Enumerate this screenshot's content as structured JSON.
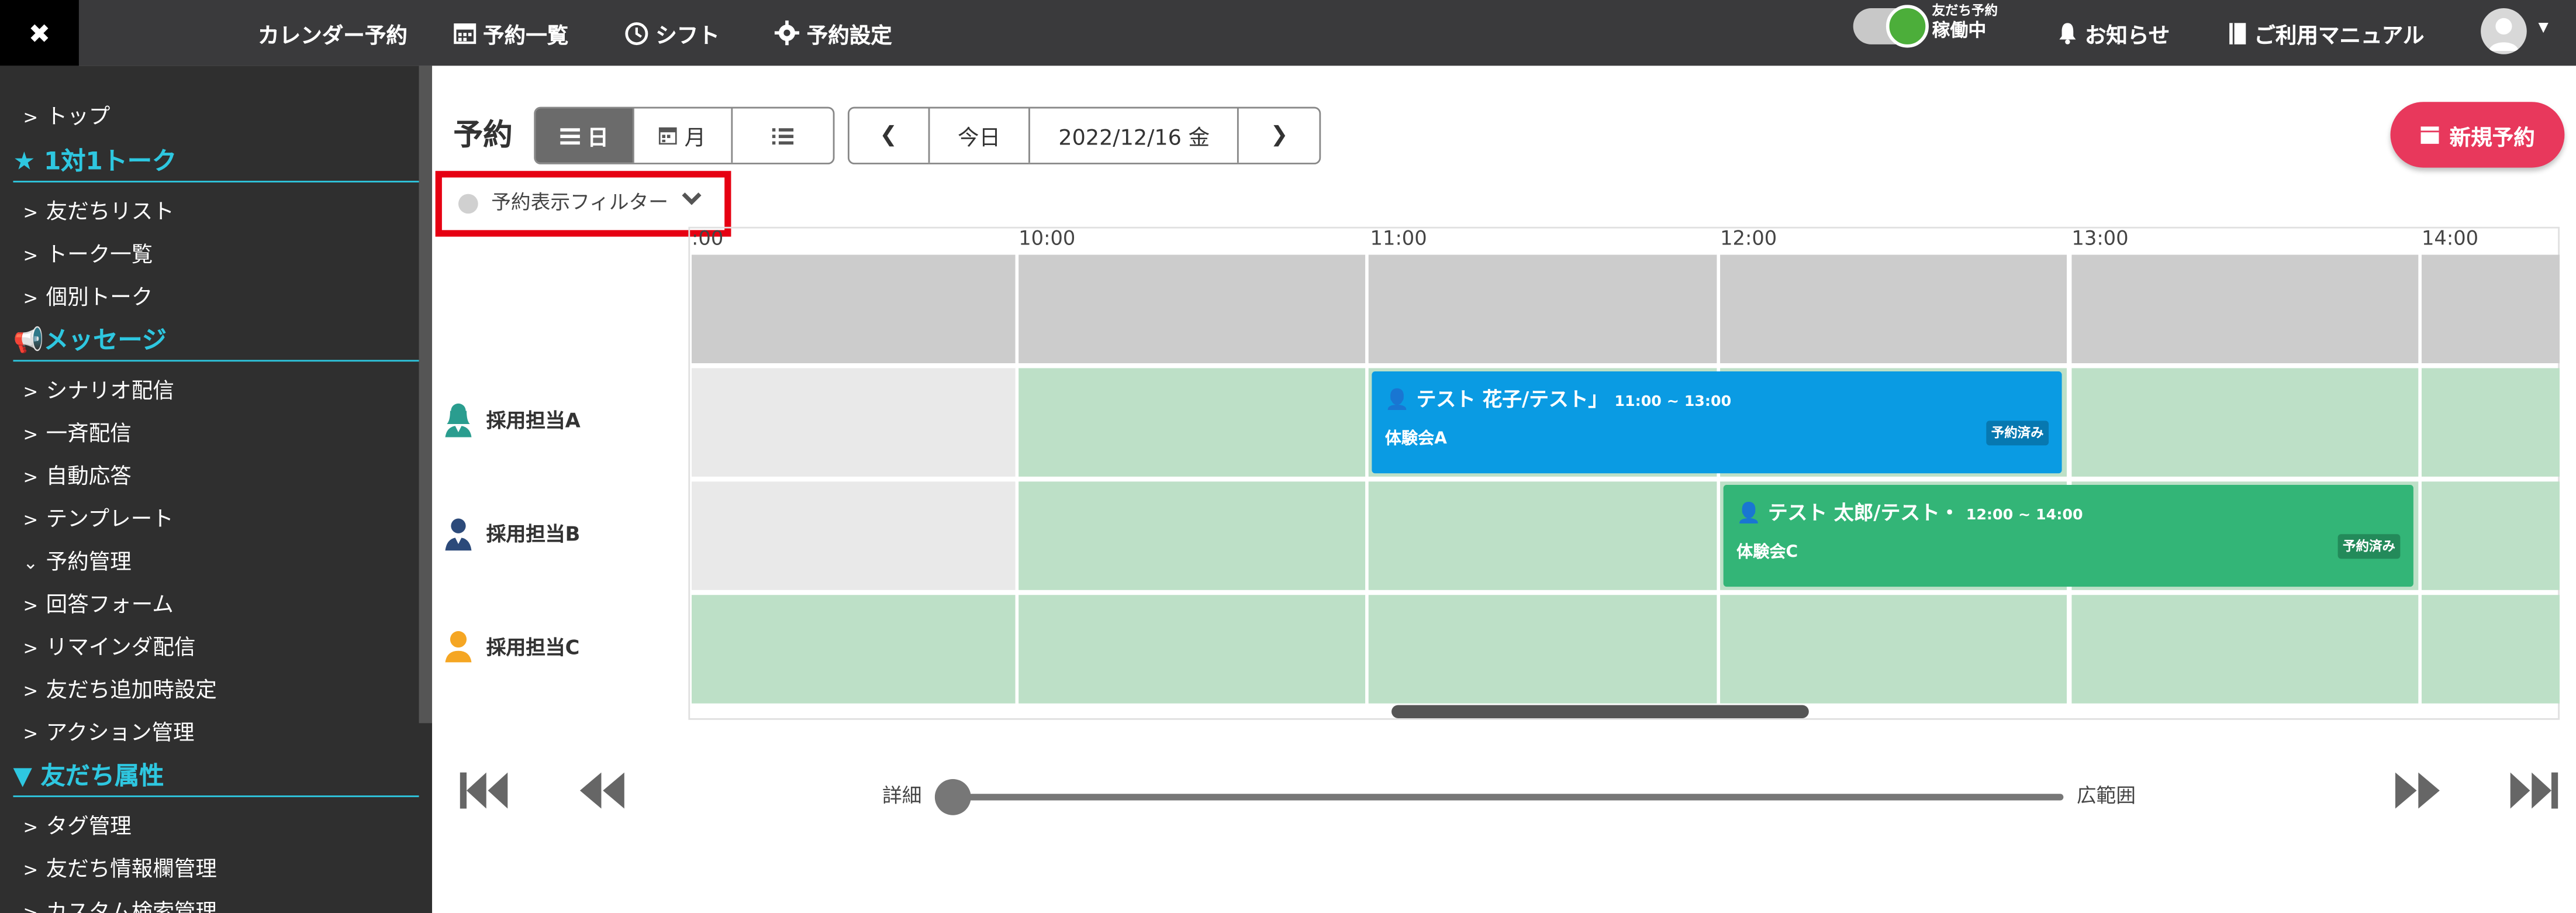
{
  "topbar": {
    "close": "✖",
    "nav": [
      "カレンダー予約",
      "予約一覧",
      "シフト",
      "予約設定"
    ],
    "status_small": "友だち予約",
    "status_main": "稼働中",
    "notice": "お知らせ",
    "manual": "ご利用マニュアル"
  },
  "sidebar": {
    "top": "トップ",
    "section1": "1対1トーク",
    "s1_items": [
      "友だちリスト",
      "トーク一覧",
      "個別トーク"
    ],
    "section2": "メッセージ",
    "s2_items": [
      "シナリオ配信",
      "一斉配信",
      "自動応答",
      "テンプレート",
      "予約管理",
      "回答フォーム",
      "リマインダ配信",
      "友だち追加時設定",
      "アクション管理"
    ],
    "section3": "友だち属性",
    "s3_items": [
      "タグ管理",
      "友だち情報欄管理",
      "カスタム検索管理"
    ]
  },
  "header": {
    "title": "予約",
    "view_day": "日",
    "view_month": "月",
    "today": "今日",
    "date": "2022/12/16 金",
    "new_button": "新規予約",
    "filter": "予約表示フィルター"
  },
  "timeline": {
    "hours": [
      ":00",
      "10:00",
      "11:00",
      "12:00",
      "13:00",
      "14:00"
    ],
    "staff": [
      "採用担当A",
      "採用担当B",
      "採用担当C"
    ],
    "events": [
      {
        "name": "テスト 花子/テスト」",
        "time": "11:00 ~ 13:00",
        "event": "体験会A",
        "status": "予約済み",
        "color": "#0a9be3"
      },
      {
        "name": "テスト 太郎/テスト・",
        "time": "12:00 ~ 14:00",
        "event": "体験会C",
        "status": "予約済み",
        "color": "#33b577"
      }
    ]
  },
  "zoom": {
    "detail": "詳細",
    "wide": "広範囲"
  },
  "colors": {
    "accent": "#2ec7e0",
    "brand_red": "#e8385c",
    "available": "#bde0c7",
    "blocked": "#cccccc"
  }
}
